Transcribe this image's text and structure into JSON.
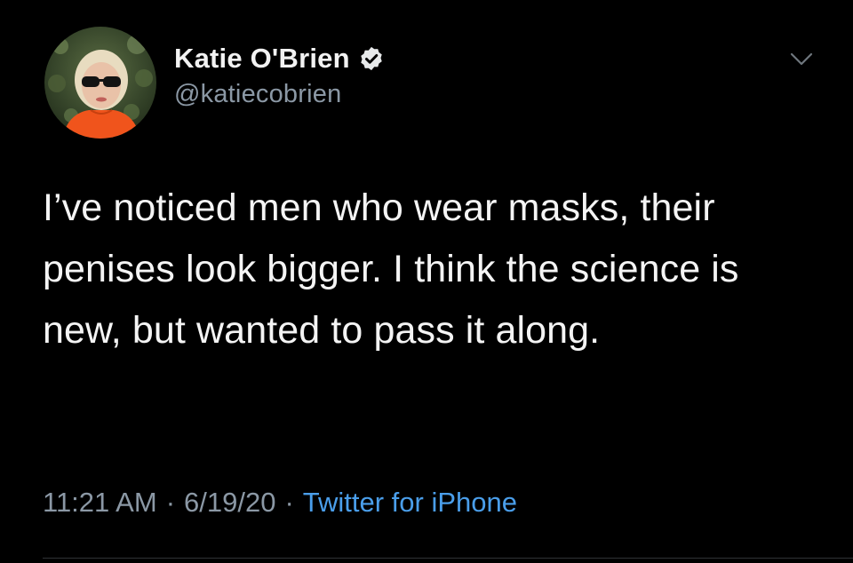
{
  "tweet": {
    "author": {
      "display_name": "Katie O'Brien",
      "handle": "@katiecobrien",
      "verified": true
    },
    "text": "I’ve noticed men who wear masks, their penises look bigger. I think the science is new, but wanted to pass it along.",
    "meta": {
      "time": "11:21 AM",
      "separator": "·",
      "date": "6/19/20",
      "source": "Twitter for iPhone"
    }
  },
  "icons": {
    "verified": "verified-badge-icon",
    "menu": "chevron-down-icon"
  },
  "colors": {
    "background": "#000000",
    "text": "#f4f4f4",
    "secondary_text": "#8b98a5",
    "link": "#4a9eea",
    "verified_badge": "#e7e9ea"
  }
}
